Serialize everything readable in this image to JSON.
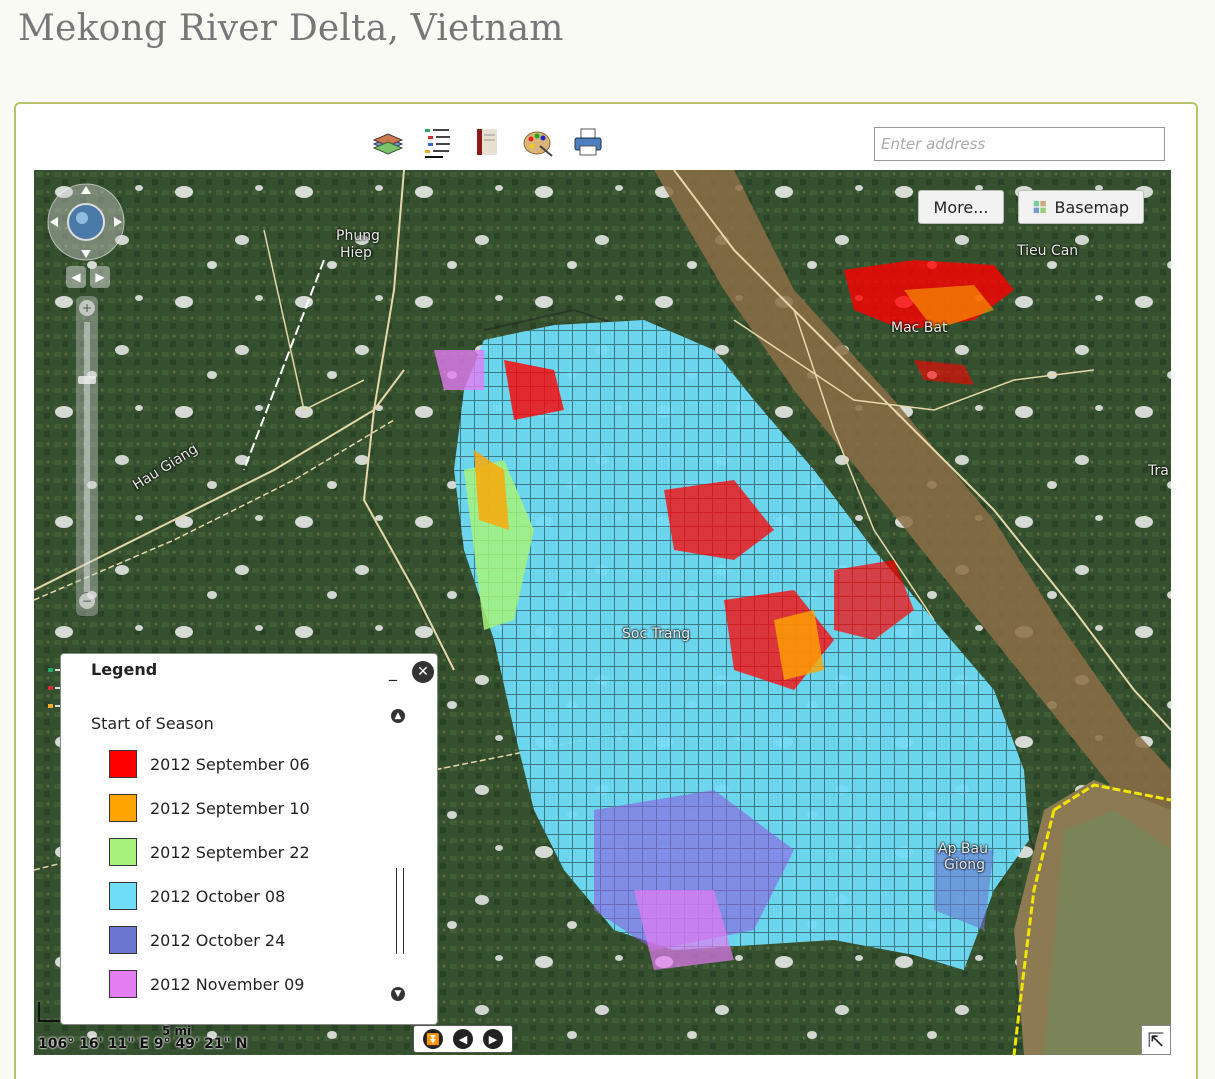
{
  "page": {
    "title": "Mekong River Delta, Vietnam"
  },
  "toolbar": {
    "tools": [
      {
        "name": "layers",
        "icon": "layers-icon"
      },
      {
        "name": "legend",
        "icon": "legend-list-icon"
      },
      {
        "name": "bookmarks",
        "icon": "book-icon"
      },
      {
        "name": "styles",
        "icon": "palette-icon"
      },
      {
        "name": "print",
        "icon": "printer-icon"
      }
    ]
  },
  "search": {
    "placeholder": "Enter address",
    "value": ""
  },
  "map_buttons": {
    "more": "More...",
    "basemap": "Basemap"
  },
  "places": {
    "phung_hiep_1": "Phung",
    "phung_hiep_2": "Hiep",
    "hau_giang": "Hau Giang",
    "tieu_can": "Tieu Can",
    "mac_bat": "Mac Bat",
    "soc_trang": "Soc Trang",
    "ap_bau_giong_1": "Ap Bau",
    "ap_bau_giong_2": "Giong",
    "tra": "Tra"
  },
  "legend": {
    "title": "Legend",
    "minimize": "_",
    "close": "✕",
    "layer_title": "Start of Season",
    "items": [
      {
        "label": "2012 September 06",
        "color": "#ff0000"
      },
      {
        "label": "2012 September 10",
        "color": "#ffa500"
      },
      {
        "label": "2012 September 22",
        "color": "#a6f27a"
      },
      {
        "label": "2012 October 08",
        "color": "#6fdcf8"
      },
      {
        "label": "2012 October 24",
        "color": "#6a76d0"
      },
      {
        "label": "2012 November 09",
        "color": "#e47cf2"
      }
    ]
  },
  "status": {
    "coordinates": "106° 16' 11\" E 9° 49' 21\" N",
    "scale": "5 mi"
  },
  "pager": {
    "first": "⏬",
    "prev": "◀",
    "next": "▶"
  },
  "expand": "⇱"
}
